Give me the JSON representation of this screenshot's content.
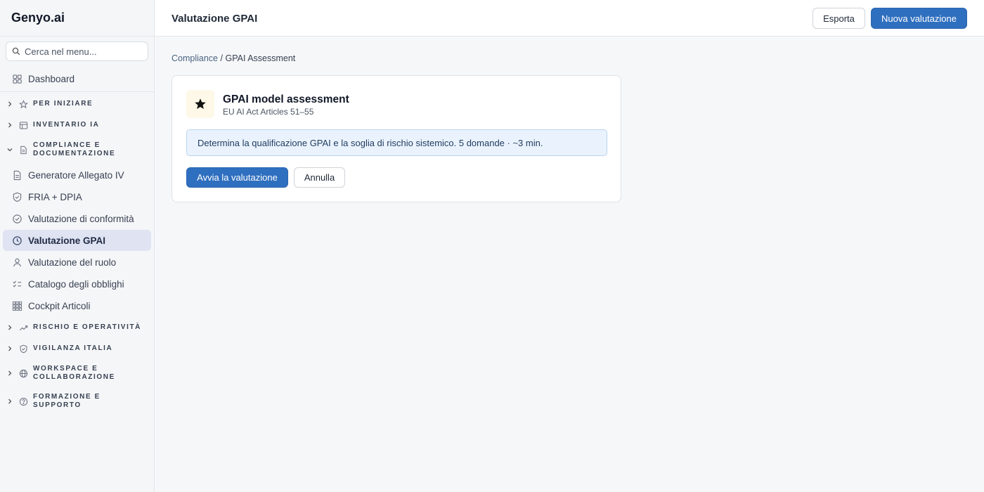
{
  "app": {
    "brand": "Genyo.ai"
  },
  "sidebar": {
    "search_placeholder": "Cerca nel menu...",
    "dashboard": {
      "label": "Dashboard",
      "icon": "grid-icon"
    },
    "sections": [
      {
        "label": "PER INIZIARE",
        "icon": "star-icon",
        "expanded": false
      },
      {
        "label": "INVENTARIO IA",
        "icon": "table-icon",
        "expanded": false
      },
      {
        "label": "COMPLIANCE E DOCUMENTAZIONE",
        "line1": "COMPLIANCE E",
        "line2": "DOCUMENTAZIONE",
        "icon": "document-icon",
        "expanded": true
      },
      {
        "label": "RISCHIO E OPERATIVITÀ",
        "icon": "trend-icon",
        "expanded": false
      },
      {
        "label": "VIGILANZA ITALIA",
        "icon": "shield-icon",
        "expanded": false
      },
      {
        "label": "WORKSPACE E COLLABORAZIONE",
        "line1": "WORKSPACE E",
        "line2": "COLLABORAZIONE",
        "icon": "globe-icon",
        "expanded": false
      },
      {
        "label": "FORMAZIONE E SUPPORTO",
        "line1": "FORMAZIONE E",
        "line2": "SUPPORTO",
        "icon": "help-icon",
        "expanded": false
      }
    ],
    "compliance_items": [
      {
        "label": "Generatore Allegato IV",
        "icon": "file-icon",
        "active": false
      },
      {
        "label": "FRIA + DPIA",
        "icon": "shield-icon",
        "active": false
      },
      {
        "label": "Valutazione di conformità",
        "icon": "check-circle-icon",
        "active": false
      },
      {
        "label": "Valutazione GPAI",
        "icon": "clock-icon",
        "active": true
      },
      {
        "label": "Valutazione del ruolo",
        "icon": "user-icon",
        "active": false
      },
      {
        "label": "Catalogo degli obblighi",
        "icon": "checklist-icon",
        "active": false
      },
      {
        "label": "Cockpit Articoli",
        "icon": "grid-dense-icon",
        "active": false
      }
    ]
  },
  "header": {
    "title": "Valutazione GPAI",
    "export_label": "Esporta",
    "new_label": "Nuova valutazione"
  },
  "breadcrumb": {
    "parent": "Compliance",
    "separator": "/",
    "current": "GPAI Assessment"
  },
  "card": {
    "icon": "star-icon",
    "title": "GPAI model assessment",
    "subtitle": "EU AI Act Articles 51–55",
    "info": "Determina la qualificazione GPAI e la soglia di rischio sistemico. 5 domande · ~3 min.",
    "start_label": "Avvia la valutazione",
    "cancel_label": "Annulla"
  },
  "colors": {
    "primary": "#2f6fbf",
    "active_nav_bg": "#dfe3f2",
    "info_bg": "#eaf3fd",
    "info_border": "#b9d3f0",
    "card_icon_bg": "#fdf8e7"
  }
}
